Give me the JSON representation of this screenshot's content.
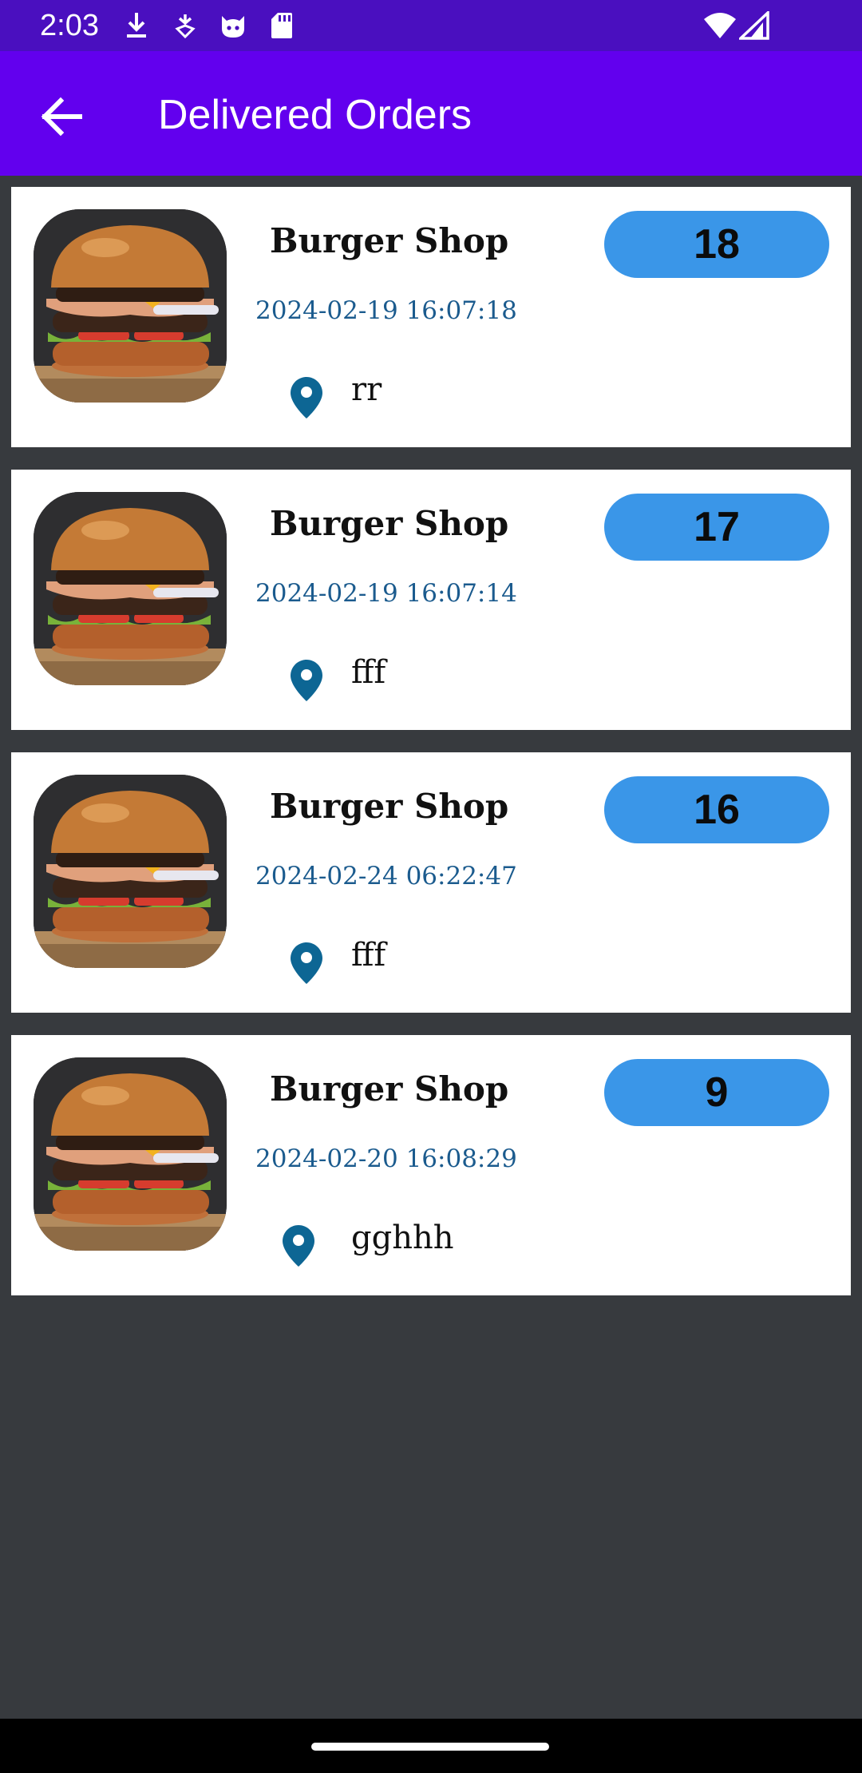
{
  "status_bar": {
    "time": "2:03",
    "left_icons": [
      "download-icon",
      "notification-icon",
      "cat-icon",
      "sd-card-icon"
    ],
    "right_icons": [
      "wifi-icon",
      "cell-signal-icon"
    ]
  },
  "app_bar": {
    "title": "Delivered Orders",
    "back_icon": "arrow-left-icon",
    "color": "#6200ee"
  },
  "orders": [
    {
      "shop": "Burger Shop",
      "date": "2024-02-19 16:07:18",
      "address": "rr",
      "number": "18"
    },
    {
      "shop": "Burger Shop",
      "date": "2024-02-19 16:07:14",
      "address": "fff",
      "number": "17"
    },
    {
      "shop": "Burger Shop",
      "date": "2024-02-24 06:22:47",
      "address": "fff",
      "number": "16"
    },
    {
      "shop": "Burger Shop",
      "date": "2024-02-20 16:08:29",
      "address": "gghhh",
      "number": "9"
    }
  ],
  "colors": {
    "status_bar": "#4a0fbf",
    "badge": "#3a96e8",
    "date_text": "#1b5b8e",
    "pin": "#0d6694",
    "background": "#373a3e"
  }
}
